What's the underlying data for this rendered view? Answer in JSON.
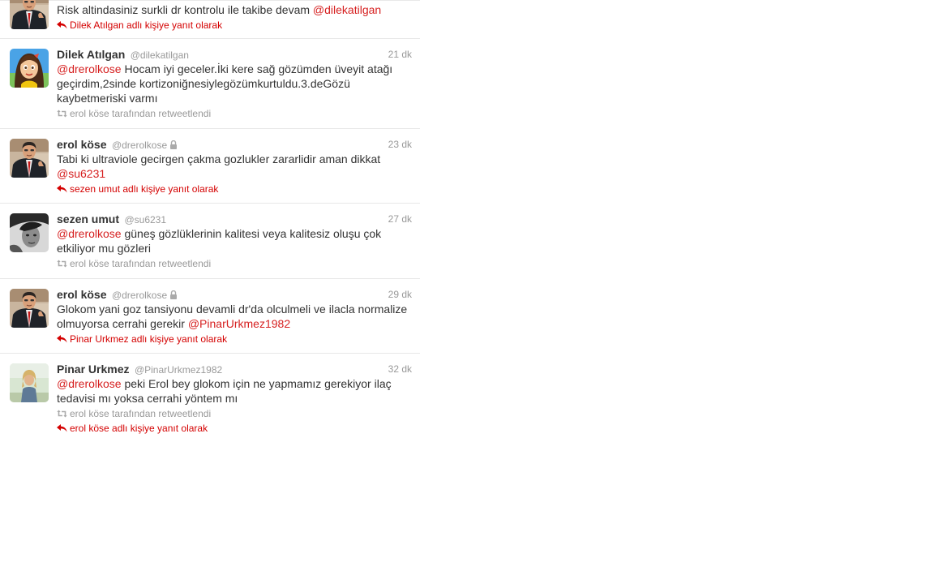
{
  "tweets": [
    {
      "partial": true,
      "text_before": "Risk altindasiniz surkli dr kontrolu ile takibe devam ",
      "mention": "@dilekatilgan",
      "text_after": "",
      "reply_label": "Dilek Atılgan adlı kişiye yanıt olarak"
    },
    {
      "name": "Dilek Atılgan",
      "handle": "@dilekatilgan",
      "time": "21 dk",
      "mention": "@drerolkose",
      "text": " Hocam iyi geceler.İki kere sağ gözümden üveyit atağı geçirdim,2sinde kortizoniğnesiylegözümkurtuldu.3.deGözü kaybetmeriski varmı",
      "retweet_label": "erol köse tarafından retweetlendi"
    },
    {
      "name": "erol köse",
      "handle": "@drerolkose",
      "time": "23 dk",
      "text": "Tabi ki ultraviole gecirgen çakma gozlukler zararlidir aman dikkat ",
      "mention": "@su6231",
      "reply_label": "sezen umut adlı kişiye yanıt olarak"
    },
    {
      "name": "sezen umut",
      "handle": "@su6231",
      "time": "27 dk",
      "mention": "@drerolkose",
      "text": " güneş gözlüklerinin kalitesi veya kalitesiz oluşu çok etkiliyor mu gözleri",
      "retweet_label": "erol köse tarafından retweetlendi"
    },
    {
      "name": "erol köse",
      "handle": "@drerolkose",
      "time": "29 dk",
      "text": "Glokom yani goz tansiyonu devamli dr'da olculmeli ve ilacla normalize olmuyorsa cerrahi gerekir ",
      "mention": "@PinarUrkmez1982",
      "reply_label": "Pinar Urkmez adlı kişiye yanıt olarak"
    },
    {
      "name": "Pinar Urkmez",
      "handle": "@PinarUrkmez1982",
      "time": "32 dk",
      "mention": "@drerolkose",
      "text": " peki Erol bey glokom için ne yapmamız gerekiyor ilaç tedavisi mı yoksa cerrahi yöntem mı",
      "retweet_label": "erol köse tarafından retweetlendi",
      "reply_label": "erol köse adlı kişiye yanıt olarak"
    }
  ],
  "icons": {
    "reply": "reply-arrow-icon",
    "retweet": "retweet-icon",
    "lock": "lock-icon"
  },
  "colors": {
    "mention": "#d62020",
    "reply": "#d40000",
    "muted": "#999999",
    "text": "#333333",
    "divider": "#e8e8e8"
  }
}
